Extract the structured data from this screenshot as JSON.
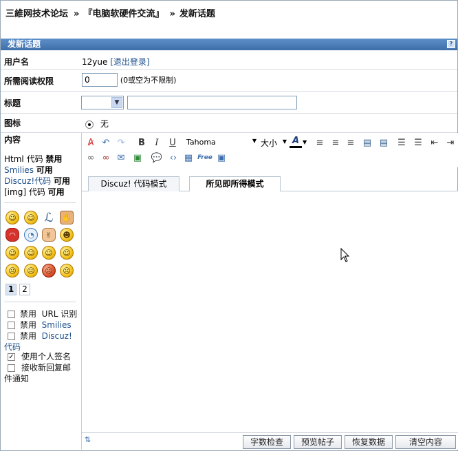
{
  "breadcrumb": {
    "site": "三維网技术论坛",
    "forum": "『电脑软硬件交流』",
    "page": "发新话题",
    "sep": "»"
  },
  "title": "发新话题",
  "username": {
    "label": "用户名",
    "value": "12yue",
    "logout": "[退出登录]"
  },
  "readperm": {
    "label": "所需阅读权限",
    "value": "0",
    "hint": "(0或空为不限制)"
  },
  "subject": {
    "label": "标题",
    "type_value": "",
    "value": ""
  },
  "icon": {
    "label": "图标",
    "value": "无"
  },
  "content": {
    "label": "内容",
    "perms": [
      {
        "name": "Html 代码",
        "state": "禁用"
      },
      {
        "name": "Smilies",
        "state": "可用"
      },
      {
        "name": "Discuz!代码",
        "state": "可用"
      },
      {
        "name": "[img] 代码",
        "state": "可用"
      }
    ],
    "pages": [
      "1",
      "2"
    ],
    "options": [
      {
        "text1": "禁用",
        "text2": "URL 识别",
        "checked": false
      },
      {
        "text1": "禁用",
        "text2": "Smilies",
        "checked": false
      },
      {
        "text1": "禁用",
        "text2": "Discuz!代码",
        "checked": false
      },
      {
        "text1": "使用个人签名",
        "text2": "",
        "checked": true
      },
      {
        "text1": "接收新回复邮件通知",
        "text2": "",
        "checked": false
      }
    ]
  },
  "editor": {
    "font": "Tahoma",
    "size": "大小",
    "tabs": [
      "Discuz! 代码模式",
      "所见即所得模式"
    ],
    "active_tab": 1,
    "buttons": [
      "字数检查",
      "预览帖子",
      "恢复数据",
      "清空内容"
    ]
  }
}
